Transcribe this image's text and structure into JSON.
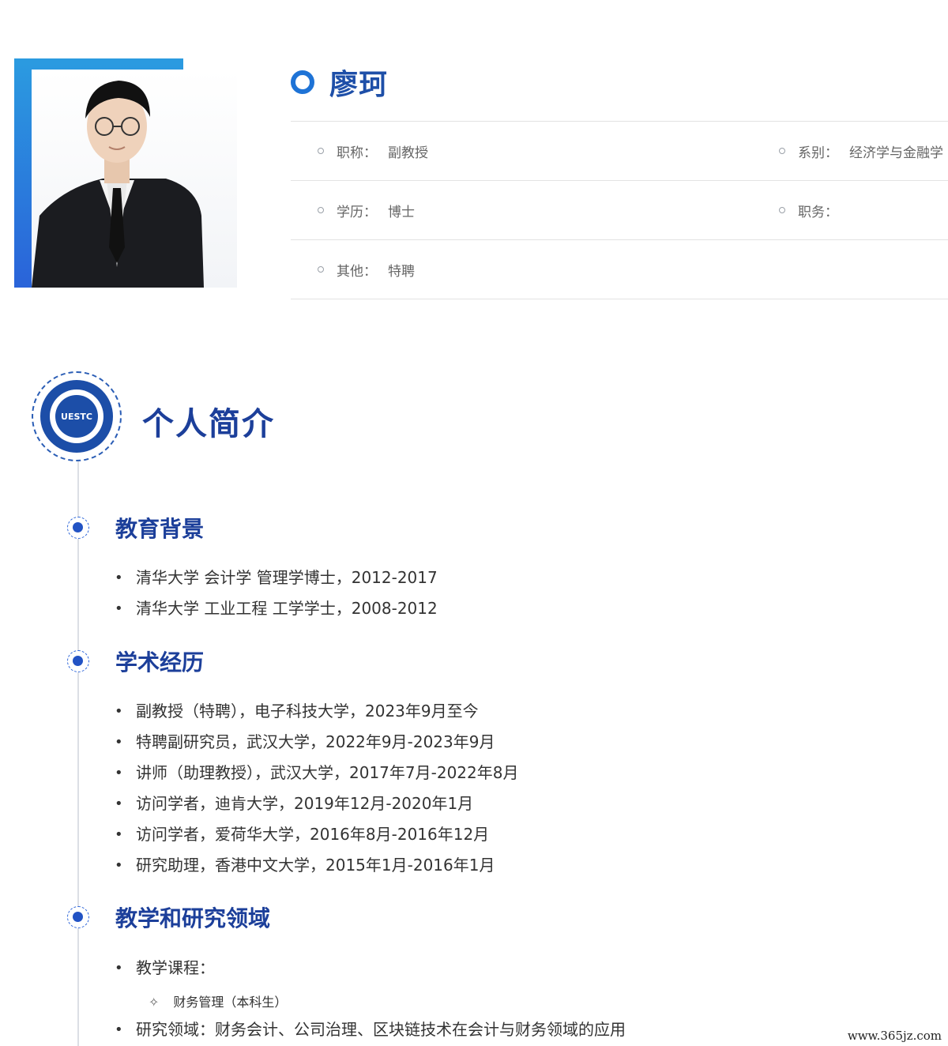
{
  "profile": {
    "name": "廖珂",
    "info": [
      {
        "label": "职称：",
        "value": "副教授"
      },
      {
        "label": "系别：",
        "value": "经济学与金融学"
      },
      {
        "label": "学历：",
        "value": "博士"
      },
      {
        "label": "职务：",
        "value": ""
      },
      {
        "label": "其他：",
        "value": "特聘"
      }
    ]
  },
  "intro": {
    "title": "个人简介",
    "logo_text": "UESTC"
  },
  "sections": {
    "education": {
      "title": "教育背景",
      "items": [
        "清华大学 会计学 管理学博士，2012-2017",
        "清华大学 工业工程 工学学士，2008-2012"
      ]
    },
    "academic": {
      "title": "学术经历",
      "items": [
        "副教授（特聘），电子科技大学，2023年9月至今",
        "特聘副研究员，武汉大学，2022年9月-2023年9月",
        "讲师（助理教授），武汉大学，2017年7月-2022年8月",
        "访问学者，迪肯大学，2019年12月-2020年1月",
        "访问学者，爱荷华大学，2016年8月-2016年12月",
        "研究助理，香港中文大学，2015年1月-2016年1月"
      ]
    },
    "teaching": {
      "title": "教学和研究领域",
      "courses_label": "教学课程：",
      "course_items": [
        "财务管理（本科生）"
      ],
      "research_label": "研究领域：财务会计、公司治理、区块链技术在会计与财务领域的应用"
    }
  },
  "watermark": "www.365jz.com",
  "colors": {
    "accent": "#1e4fa8",
    "gradient_top": "#2b9be0",
    "gradient_bottom": "#2a63d9"
  }
}
